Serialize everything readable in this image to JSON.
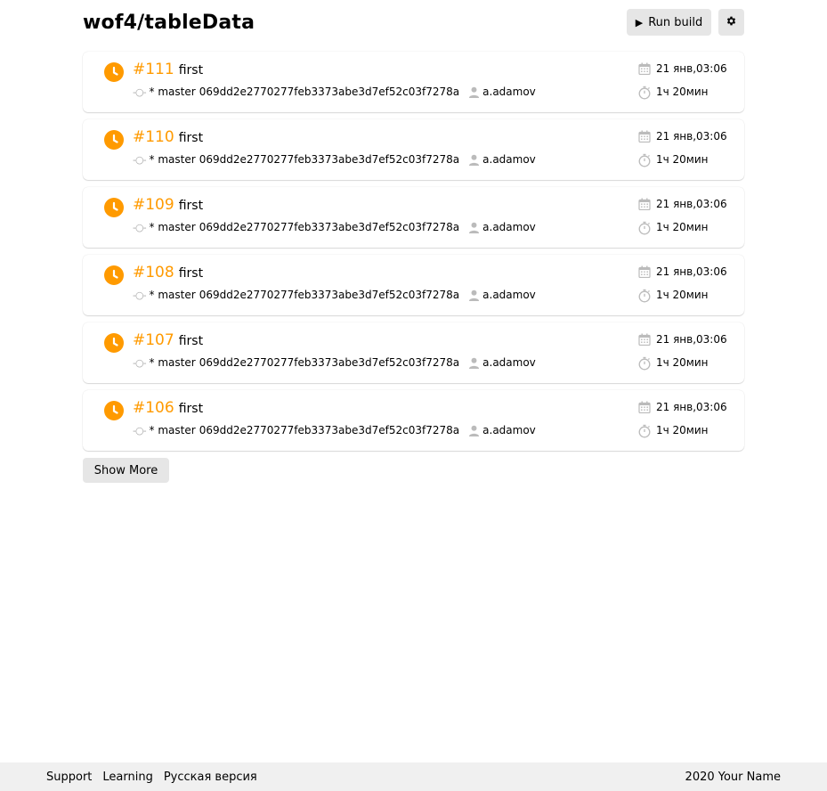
{
  "header": {
    "title": "wof4/tableData",
    "run_build_label": "Run build",
    "settings_icon": "gear-icon"
  },
  "builds": [
    {
      "number": "#111",
      "message": "first",
      "branch": "* master",
      "commit": "069dd2e2770277feb3373abe3d7ef52c03f7278a",
      "author": "a.adamov",
      "date": "21 янв,03:06",
      "duration": "1ч 20мин",
      "status": "pending"
    },
    {
      "number": "#110",
      "message": "first",
      "branch": "* master",
      "commit": "069dd2e2770277feb3373abe3d7ef52c03f7278a",
      "author": "a.adamov",
      "date": "21 янв,03:06",
      "duration": "1ч 20мин",
      "status": "pending"
    },
    {
      "number": "#109",
      "message": "first",
      "branch": "* master",
      "commit": "069dd2e2770277feb3373abe3d7ef52c03f7278a",
      "author": "a.adamov",
      "date": "21 янв,03:06",
      "duration": "1ч 20мин",
      "status": "pending"
    },
    {
      "number": "#108",
      "message": "first",
      "branch": "* master",
      "commit": "069dd2e2770277feb3373abe3d7ef52c03f7278a",
      "author": "a.adamov",
      "date": "21 янв,03:06",
      "duration": "1ч 20мин",
      "status": "pending"
    },
    {
      "number": "#107",
      "message": "first",
      "branch": "* master",
      "commit": "069dd2e2770277feb3373abe3d7ef52c03f7278a",
      "author": "a.adamov",
      "date": "21 янв,03:06",
      "duration": "1ч 20мин",
      "status": "pending"
    },
    {
      "number": "#106",
      "message": "first",
      "branch": "* master",
      "commit": "069dd2e2770277feb3373abe3d7ef52c03f7278a",
      "author": "a.adamov",
      "date": "21 янв,03:06",
      "duration": "1ч 20мин",
      "status": "pending"
    }
  ],
  "show_more_label": "Show More",
  "footer": {
    "links": [
      "Support",
      "Learning",
      "Русская версия"
    ],
    "copyright": "2020 Your Name"
  },
  "colors": {
    "accent": "#ff9a00",
    "button_bg": "#e6e6e6",
    "footer_bg": "#f0f0f0",
    "icon_gray": "#bbbbbb"
  }
}
